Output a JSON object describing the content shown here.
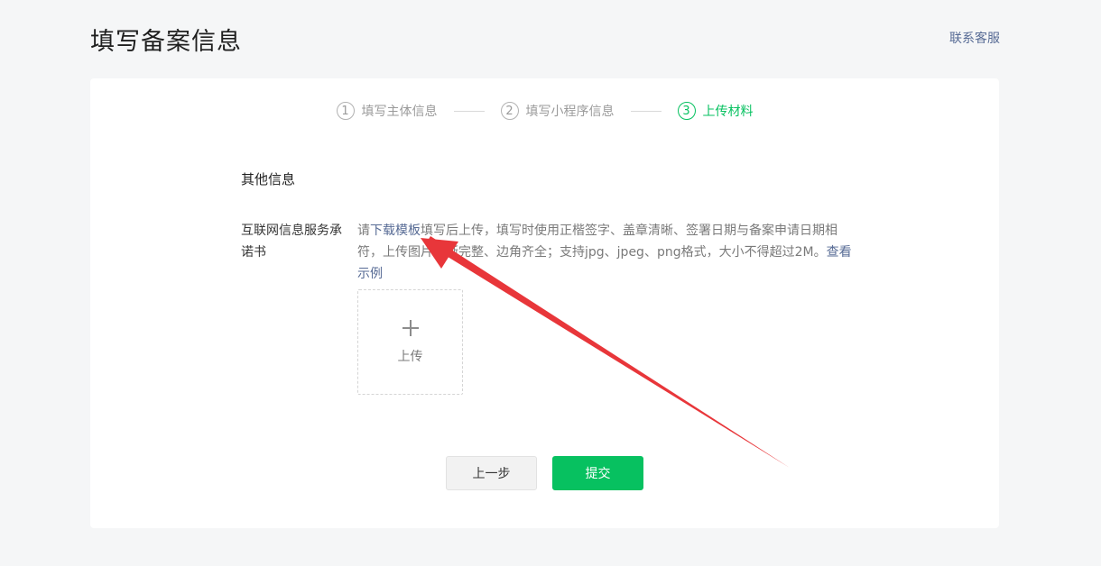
{
  "header": {
    "title": "填写备案信息",
    "contact_label": "联系客服"
  },
  "steps": [
    {
      "number": "1",
      "label": "填写主体信息",
      "state": "done"
    },
    {
      "number": "2",
      "label": "填写小程序信息",
      "state": "done"
    },
    {
      "number": "3",
      "label": "上传材料",
      "state": "active"
    }
  ],
  "section": {
    "title": "其他信息"
  },
  "field": {
    "label": "互联网信息服务承诺书",
    "desc_prefix": "请",
    "download_link": "下载模板",
    "desc_main": "填写后上传，填写时使用正楷签字、盖章清晰、签署日期与备案申请日期相符，上传图片清晰完整、边角齐全；支持jpg、jpeg、png格式，大小不得超过2M。",
    "example_link": "查看示例"
  },
  "upload": {
    "icon": "plus-icon",
    "label": "上传"
  },
  "buttons": {
    "prev_label": "上一步",
    "submit_label": "提交"
  },
  "colors": {
    "accent": "#07c160",
    "link": "#576b95",
    "annotation_arrow": "#e8363a"
  }
}
